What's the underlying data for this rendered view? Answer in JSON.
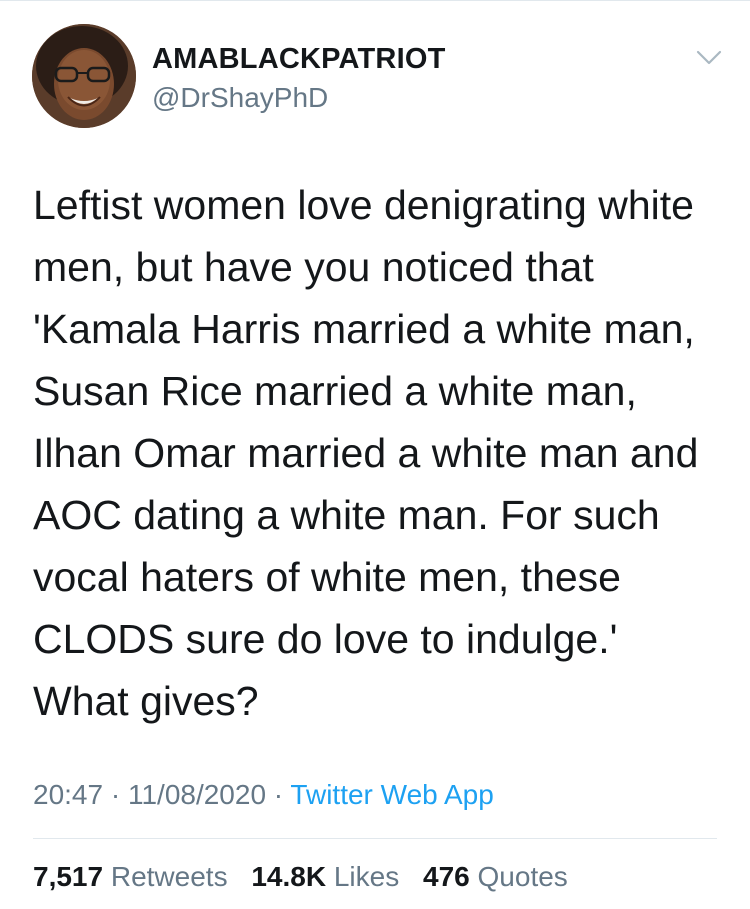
{
  "author": {
    "display_name": "AMABLACKPATRIOT",
    "handle": "@DrShayPhD",
    "avatar_icon": "profile-photo"
  },
  "menu": {
    "icon": "chevron-down-icon"
  },
  "tweet": {
    "text": "Leftist women love denigrating white\nmen, but have you noticed that\n'Kamala Harris married a white man,\nSusan Rice married a white man,\nIlhan Omar married a white man and\nAOC dating a white man. For such\nvocal haters of white men, these\nCLODS sure do love to indulge.'\nWhat gives?"
  },
  "meta": {
    "time": "20:47",
    "separator": " · ",
    "date": "11/08/2020",
    "source": "Twitter Web App"
  },
  "stats": {
    "retweets_count": "7,517",
    "retweets_label": "Retweets",
    "likes_count": "14.8K",
    "likes_label": "Likes",
    "quotes_count": "476",
    "quotes_label": "Quotes"
  },
  "colors": {
    "text": "#14171a",
    "secondary": "#657786",
    "link": "#1da1f2",
    "divider": "#e1e8ed"
  }
}
